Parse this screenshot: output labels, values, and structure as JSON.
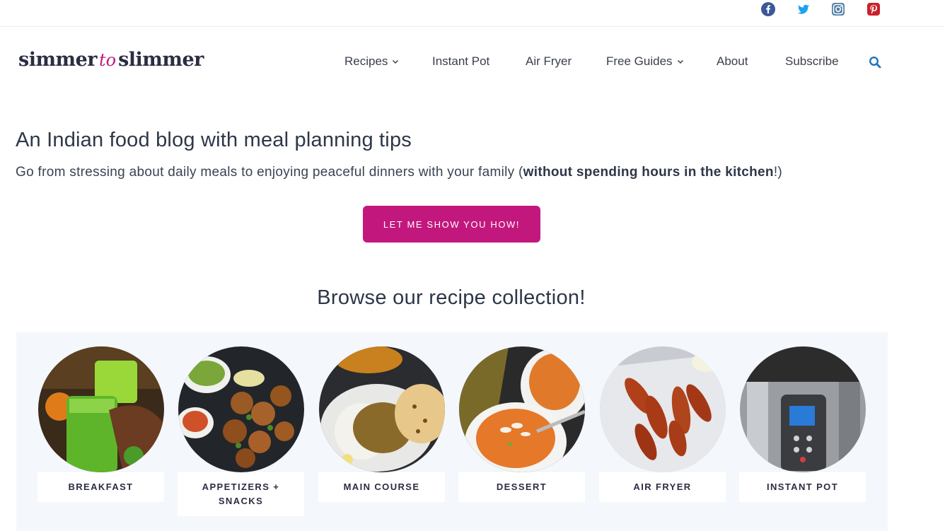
{
  "social": [
    {
      "name": "facebook-icon",
      "color": "#3b5998"
    },
    {
      "name": "twitter-icon",
      "color": "#1da1f2"
    },
    {
      "name": "instagram-icon",
      "color": "#517fa4"
    },
    {
      "name": "pinterest-icon",
      "color": "#cb2027"
    }
  ],
  "logo": {
    "part1": "simmer",
    "part2": "to",
    "part3": "slimmer"
  },
  "nav": {
    "items": [
      "Recipes",
      "Instant Pot",
      "Air Fryer",
      "Free Guides",
      "About",
      "Subscribe"
    ],
    "search_icon": "search-icon"
  },
  "hero": {
    "title": "An Indian food blog with meal planning tips",
    "subtitle_pre": "Go from stressing about daily meals to enjoying peaceful dinners with your family (",
    "subtitle_bold": "without spending hours in the kitchen",
    "subtitle_post": "!)",
    "cta": "LET ME SHOW YOU HOW!"
  },
  "browse": {
    "title": "Browse our recipe collection!",
    "categories": [
      "BREAKFAST",
      "APPETIZERS + SNACKS",
      "MAIN COURSE",
      "DESSERT",
      "AIR FRYER",
      "INSTANT POT"
    ]
  },
  "colors": {
    "accent": "#c2187d",
    "panel": "#f4f7fb",
    "search": "#1e73be"
  }
}
